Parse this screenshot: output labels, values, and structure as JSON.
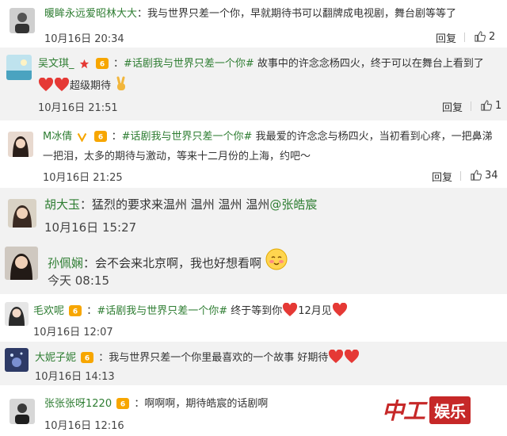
{
  "comments": [
    {
      "username": "暖眸永远爱昭林大大",
      "content": "：我与世界只差一个你，早就期待书可以翻牌成电视剧，舞台剧等等了",
      "time": "10月16日 20:34",
      "reply": "回复",
      "likes": "2"
    },
    {
      "username": "吴文琪_",
      "topic": "#话剧我与世界只差一个你#",
      "content": " 故事中的许念念杨四火，终于可以在舞台上看到了",
      "content2": "超级期待",
      "time": "10月16日 21:51",
      "reply": "回复",
      "likes": "1"
    },
    {
      "username": "M冰倩",
      "topic": "#话剧我与世界只差一个你#",
      "content": " 我最爱的许念念与杨四火，当初看到心疼，一把鼻涕",
      "content2": "一把泪，太多的期待与激动，等来十二月份的上海，约吧～",
      "time": "10月16日 21:25",
      "reply": "回复",
      "likes": "34"
    },
    {
      "username": "胡大玉",
      "content": "：猛烈的要求来温州 温州 温州 温州",
      "mention": "@张皓宸",
      "time": "10月16日 15:27"
    },
    {
      "username": "孙佩娴",
      "content": "：会不会来北京啊，我也好想看啊",
      "time": "今天 08:15"
    },
    {
      "username": "毛欢呢",
      "topic": "#话剧我与世界只差一个你#",
      "content": " 终于等到你",
      "content2": "12月见",
      "time": "10月16日 12:07"
    },
    {
      "username": "大妮子妮",
      "content": "：我与世界只差一个你里最喜欢的一个故事 好期待",
      "time": "10月16日 14:13"
    },
    {
      "username": "张张张呀1220",
      "content": "：啊啊啊，期待皓宸的话剧啊",
      "time": "10月16日 12:16"
    }
  ],
  "watermark": {
    "logo": "中工",
    "label": "娱乐"
  },
  "colors": {
    "username": "#2e7d32",
    "alt_row": "#f2f2f2",
    "heart": "#e53935",
    "watermark": "#c62828"
  }
}
